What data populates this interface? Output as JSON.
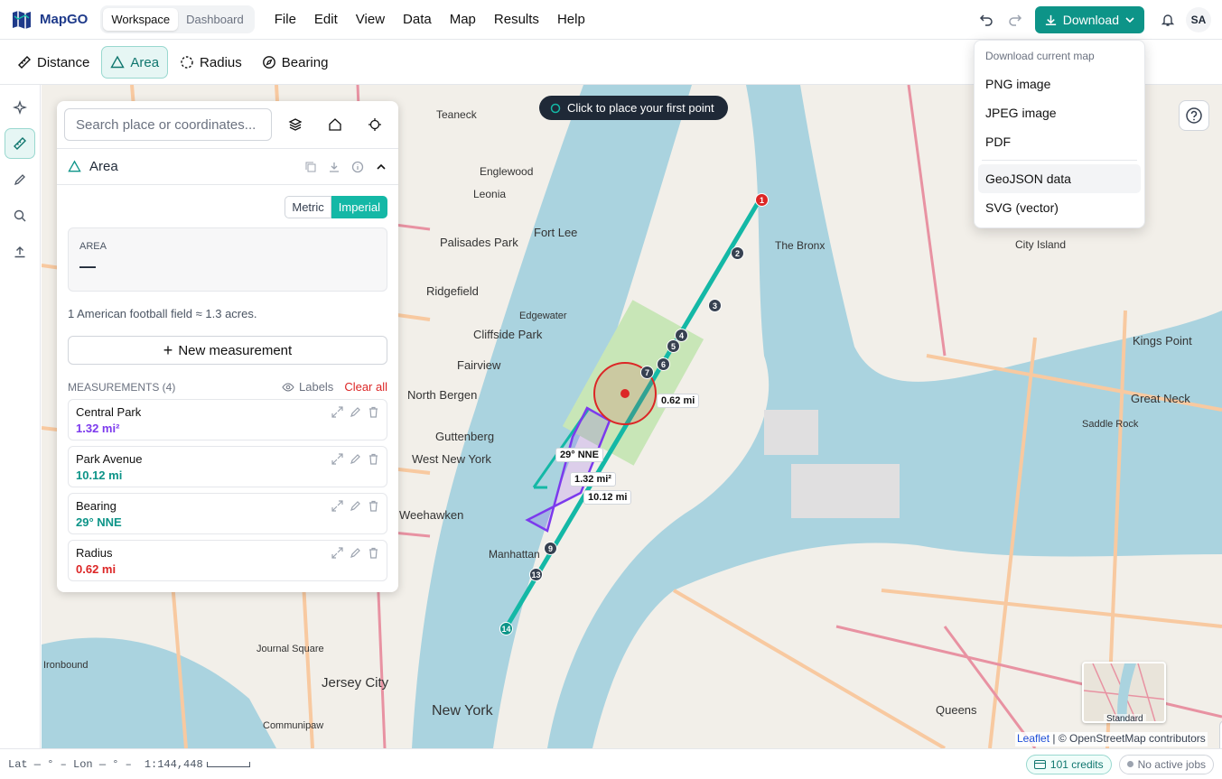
{
  "app": {
    "name": "MapGO",
    "brand_color": "#0d9488"
  },
  "view_toggle": [
    {
      "label": "Workspace",
      "active": true
    },
    {
      "label": "Dashboard",
      "active": false
    }
  ],
  "menu": [
    "File",
    "Edit",
    "View",
    "Data",
    "Map",
    "Results",
    "Help"
  ],
  "header": {
    "download_label": "Download",
    "avatar_initials": "SA"
  },
  "download_menu": {
    "heading": "Download current map",
    "items": [
      "PNG image",
      "JPEG image",
      "PDF",
      "GeoJSON data",
      "SVG (vector)"
    ],
    "highlighted": "GeoJSON data"
  },
  "tools": [
    {
      "label": "Distance",
      "icon": "ruler-icon",
      "active": false
    },
    {
      "label": "Area",
      "icon": "triangle-icon",
      "active": true
    },
    {
      "label": "Radius",
      "icon": "dashed-circle-icon",
      "active": false
    },
    {
      "label": "Bearing",
      "icon": "compass-icon",
      "active": false
    }
  ],
  "rail": [
    "sparkles-icon",
    "ruler-icon",
    "pencil-icon",
    "search-icon",
    "upload-icon"
  ],
  "search": {
    "placeholder": "Search place or coordinates..."
  },
  "panel": {
    "title": "Area",
    "units": [
      {
        "label": "Metric",
        "active": false
      },
      {
        "label": "Imperial",
        "active": true
      }
    ],
    "area_label": "AREA",
    "area_value": "—",
    "note": "1 American football field ≈ 1.3 acres.",
    "new_button": "New measurement",
    "measurements_header": "MEASUREMENTS (4)",
    "labels_toggle": "Labels",
    "clear_all": "Clear all",
    "measurements": [
      {
        "name": "Central Park",
        "value": "1.32 mi²",
        "color": "#7c3aed"
      },
      {
        "name": "Park Avenue",
        "value": "10.12 mi",
        "color": "#0d9488"
      },
      {
        "name": "Bearing",
        "value": "29° NNE",
        "color": "#0d9488"
      },
      {
        "name": "Radius",
        "value": "0.62 mi",
        "color": "#dc2626"
      }
    ]
  },
  "map": {
    "tip": "Click to place your first point",
    "labels": {
      "radius": "0.62 mi",
      "bearing": "29° NNE",
      "area": "1.32 mi²",
      "distance": "10.12 mi"
    },
    "place_names": [
      "Englewood",
      "Teaneck",
      "Leonia",
      "Fort Lee",
      "Palisades Park",
      "Ridgefield",
      "Cliffside Park",
      "Edgewater",
      "Fairview",
      "North Bergen",
      "Guttenberg",
      "West New York",
      "Weehawken",
      "Manhattan",
      "Jersey City",
      "New York",
      "The Bronx",
      "City Island",
      "Kings Point",
      "Great Neck",
      "Queens",
      "Journal Square",
      "Communipaw",
      "Ironbound",
      "Saddle Rock"
    ],
    "route_markers": [
      "1",
      "2",
      "3",
      "4",
      "5",
      "6",
      "7",
      "9",
      "13",
      "14"
    ],
    "zoom_level": "12",
    "minimap_label": "Standard",
    "attribution_link": "Leaflet",
    "attribution_text": "| © OpenStreetMap contributors"
  },
  "status": {
    "lat_lon": "Lat — ° – Lon — ° –",
    "scale": "1:144,448",
    "credits": "101 credits",
    "jobs": "No active jobs"
  }
}
